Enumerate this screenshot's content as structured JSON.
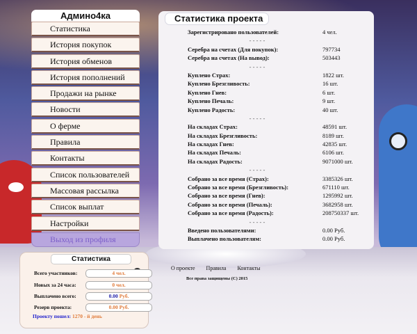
{
  "sidebar": {
    "title": "Админо4ка",
    "items": [
      {
        "label": "Статистика"
      },
      {
        "label": "История покупок"
      },
      {
        "label": "История обменов"
      },
      {
        "label": "История пополнений"
      },
      {
        "label": "Продажи на рынке"
      },
      {
        "label": "Новости"
      },
      {
        "label": "О ферме"
      },
      {
        "label": "Правила"
      },
      {
        "label": "Контакты"
      },
      {
        "label": "Список пользователей"
      },
      {
        "label": "Массовая рассылка"
      },
      {
        "label": "Список выплат"
      },
      {
        "label": "Настройки"
      }
    ],
    "logout_label": "Выход из профиля"
  },
  "main": {
    "title": "Статистика проекта",
    "separator": "- - - - -",
    "groups": [
      [
        {
          "label": "Зарегистрировано пользователей:",
          "value": "4 чел."
        }
      ],
      [
        {
          "label": "Серебра на счетах (Для покупок):",
          "value": "797734"
        },
        {
          "label": "Серебра на счетах (На вывод):",
          "value": "503443"
        }
      ],
      [
        {
          "label": "Куплено Страх:",
          "value": "1822 шт."
        },
        {
          "label": "Куплено Брезгливость:",
          "value": "16 шт."
        },
        {
          "label": "Куплено Гнев:",
          "value": "6 шт."
        },
        {
          "label": "Куплено Печаль:",
          "value": "9 шт."
        },
        {
          "label": "Куплено Радость:",
          "value": "40 шт."
        }
      ],
      [
        {
          "label": "На складах Страх:",
          "value": "48591 шт."
        },
        {
          "label": "На складах Брезгливость:",
          "value": "8189 шт."
        },
        {
          "label": "На складах Гнев:",
          "value": "42835 шт."
        },
        {
          "label": "На складах Печаль:",
          "value": "6106 шт."
        },
        {
          "label": "На складах Радость:",
          "value": "9071000 шт."
        }
      ],
      [
        {
          "label": "Собрано за все время (Страх):",
          "value": "3385326 шт."
        },
        {
          "label": "Собрано за все время (Брезгливость):",
          "value": "671110 шт."
        },
        {
          "label": "Собрано за все время (Гнев):",
          "value": "1295992 шт."
        },
        {
          "label": "Собрано за все время (Печаль):",
          "value": "3682958 шт."
        },
        {
          "label": "Собрано за все время (Радость):",
          "value": "208750337 шт."
        }
      ],
      [
        {
          "label": "Введено пользователями:",
          "value": "0.00 Руб."
        },
        {
          "label": "Выплачено пользователям:",
          "value": "0.00 Руб."
        }
      ]
    ]
  },
  "bottom_stats": {
    "title": "Статистика",
    "rows": [
      {
        "label": "Всего участников:",
        "value": "4 чел."
      },
      {
        "label": "Новых за 24 часа:",
        "value": "0 чел."
      },
      {
        "label": "Выплачено всего:",
        "value_num": "0.00",
        "value_unit": "Руб."
      },
      {
        "label": "Резерв проекта:",
        "value": "0.00 Руб."
      }
    ],
    "project_label": "Проекту пошел:",
    "project_days_num": "1270",
    "project_days_suffix": "- й день"
  },
  "footer": {
    "links": [
      {
        "label": "О проекте"
      },
      {
        "label": "Правила"
      },
      {
        "label": "Контакты"
      }
    ],
    "copyright": "Все права защищены (C) 2015"
  }
}
